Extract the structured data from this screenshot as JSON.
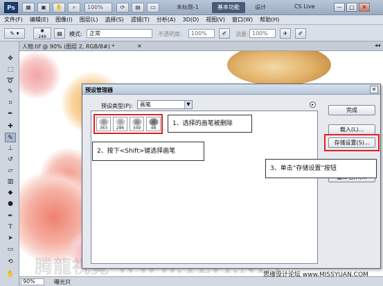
{
  "app": {
    "logo": "Ps",
    "zoom_level": "100%",
    "doc_title_top": "未标题-1",
    "workspace_label": "基本功能",
    "design_label": "设计",
    "cs_live": "CS Live",
    "window_buttons": [
      "—",
      "□",
      "✕"
    ]
  },
  "menu": {
    "items": [
      "文件(F)",
      "编辑(E)",
      "图像(I)",
      "图层(L)",
      "选择(S)",
      "滤镜(T)",
      "分析(A)",
      "3D(D)",
      "视图(V)",
      "窗口(W)",
      "帮助(H)"
    ]
  },
  "options": {
    "brush_size": "249",
    "mode_label": "模式:",
    "mode_value": "正常",
    "opacity_label": "不透明度:",
    "opacity_value": "100%",
    "flow_label": "流量:",
    "flow_value": "100%"
  },
  "document": {
    "tab_label": "人物.tif @ 90% (图层 2, RGB/8#) *",
    "tab_close": "×",
    "zoom": "90%",
    "status_text": "曝光只"
  },
  "dialog": {
    "title": "预设管理器",
    "close": "✕",
    "preset_type_label": "预设类型(P):",
    "preset_type_value": "画笔",
    "brushes": [
      {
        "size": "363",
        "color": "#9a9a9a"
      },
      {
        "size": "286",
        "color": "#b0b0b0"
      },
      {
        "size": "349",
        "color": "#8a8a8a"
      },
      {
        "size": "48",
        "color": "#666666"
      }
    ],
    "buttons": {
      "done": "完成",
      "load": "载入(L)...",
      "save": "存储设置(S)...",
      "rename": "重命名(R)..."
    }
  },
  "callouts": {
    "step1": "1、选择的画笔被删除",
    "step2": "2、按下<Shift>键选择画笔",
    "step3": "3、单击“存储设置”按钮"
  },
  "watermark": "腾龍視覺 WWW.TLVI.NET",
  "site_credit": "思缘设计论坛 www.MISSYUAN.COM"
}
